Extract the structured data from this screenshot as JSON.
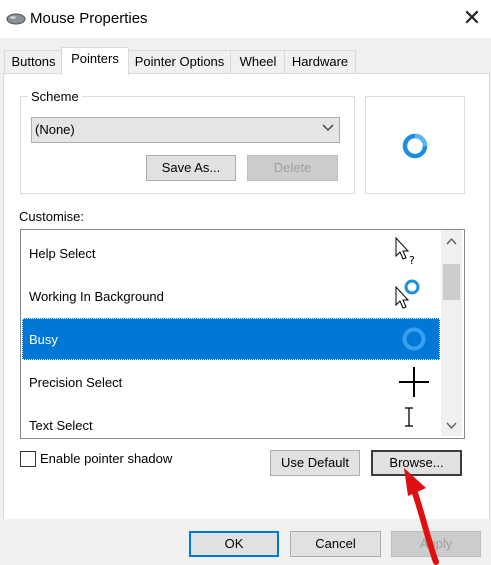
{
  "window": {
    "title": "Mouse Properties",
    "close_glyph": "✕",
    "app_icon": "mouse-icon"
  },
  "tabs": [
    {
      "label": "Buttons",
      "active": false
    },
    {
      "label": "Pointers",
      "active": true
    },
    {
      "label": "Pointer Options",
      "active": false
    },
    {
      "label": "Wheel",
      "active": false
    },
    {
      "label": "Hardware",
      "active": false
    }
  ],
  "scheme": {
    "label": "Scheme",
    "selected": "(None)",
    "save_as": "Save As...",
    "delete": "Delete"
  },
  "preview": {
    "icon": "busy-ring-icon",
    "color": "#1e8fe0"
  },
  "customise": {
    "label": "Customise:",
    "items": [
      {
        "label": "Help Select",
        "icon": "help-select-cursor-icon",
        "selected": false
      },
      {
        "label": "Working In Background",
        "icon": "working-background-cursor-icon",
        "selected": false
      },
      {
        "label": "Busy",
        "icon": "busy-ring-icon",
        "selected": true
      },
      {
        "label": "Precision Select",
        "icon": "crosshair-icon",
        "selected": false
      },
      {
        "label": "Text Select",
        "icon": "text-ibeam-icon",
        "selected": false
      }
    ]
  },
  "options": {
    "shadow_label": "Enable pointer shadow",
    "shadow_checked": false,
    "use_default": "Use Default",
    "browse": "Browse..."
  },
  "footer": {
    "ok": "OK",
    "cancel": "Cancel",
    "apply": "Apply"
  },
  "colors": {
    "selection": "#0078d7",
    "accent_ring": "#1e8fe0",
    "annotation_arrow": "#e01010"
  }
}
